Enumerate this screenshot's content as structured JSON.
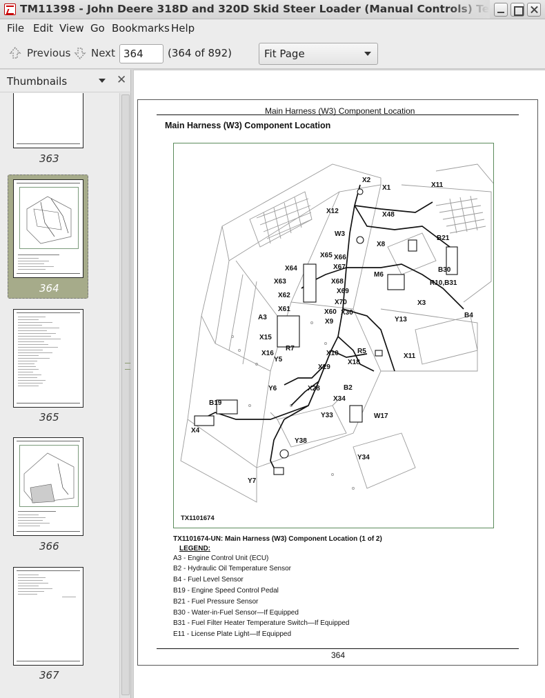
{
  "window": {
    "title": "TM11398 - John Deere 318D and 320D Skid Steer Loader (Manual Controls) Technical Manual (Operation and Test)"
  },
  "menubar": {
    "file": "File",
    "edit": "Edit",
    "view": "View",
    "go": "Go",
    "bookmarks": "Bookmarks",
    "help": "Help"
  },
  "toolbar": {
    "previous_label": "Previous",
    "next_label": "Next",
    "page_value": "364",
    "page_count": "(364 of 892)",
    "zoom_value": "Fit Page"
  },
  "sidebar": {
    "title": "Thumbnails",
    "selected_page": "364",
    "pages": [
      "363",
      "364",
      "365",
      "366",
      "367"
    ]
  },
  "document": {
    "running_header": "Main Harness (W3) Component Location",
    "section_title": "Main Harness (W3) Component Location",
    "figure_id": "TX1101674",
    "callouts": [
      "X2",
      "X1",
      "X11",
      "X12",
      "X48",
      "W3",
      "X8",
      "B21",
      "M6",
      "B30",
      "R10,B31",
      "X65",
      "X66",
      "X64",
      "X67",
      "X63",
      "X68",
      "X69",
      "X62",
      "X70",
      "X61",
      "X60",
      "X30",
      "X3",
      "A3",
      "X9",
      "B4",
      "Y13",
      "X15",
      "R7",
      "R5",
      "X16",
      "X10",
      "X11",
      "Y5",
      "X18",
      "X29",
      "Y6",
      "X28",
      "B2",
      "X34",
      "B19",
      "Y33",
      "W17",
      "X4",
      "Y38",
      "Y34",
      "Y7"
    ],
    "caption": "TX1101674-UN: Main Harness (W3) Component Location (1 of 2)",
    "legend_title": "LEGEND:",
    "legend": [
      "A3 - Engine Control Unit (ECU)",
      "B2 - Hydraulic Oil Temperature Sensor",
      "B4 - Fuel Level Sensor",
      "B19 - Engine Speed Control Pedal",
      "B21 - Fuel Pressure Sensor",
      "B30 - Water-in-Fuel Sensor—If Equipped",
      "B31 - Fuel Filter Heater Temperature Switch—If Equipped",
      "E11 - License Plate Light—If Equipped"
    ],
    "page_number": "364"
  }
}
